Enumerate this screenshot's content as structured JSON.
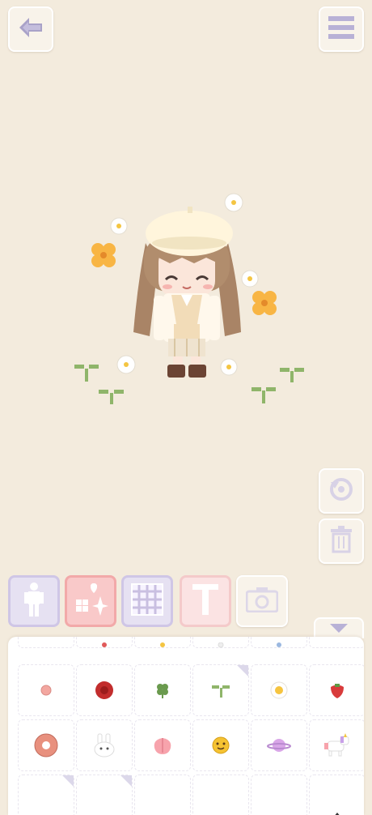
{
  "toolbar": {
    "back_icon": "arrow-left-icon",
    "menu_icon": "hamburger-menu-icon"
  },
  "side_actions": [
    {
      "name": "rotate-button",
      "icon": "rotate-icon"
    },
    {
      "name": "delete-button",
      "icon": "trash-icon"
    }
  ],
  "tabs": [
    {
      "name": "tab-character",
      "icon": "person-silhouette-icon",
      "bg": "#e6e1f2",
      "border": "#cfc6e6",
      "selected": false
    },
    {
      "name": "tab-stickers",
      "icon": "sparkle-clover-icon",
      "bg": "#f9c9c9",
      "border": "#f2a9a9",
      "selected": true
    },
    {
      "name": "tab-background",
      "icon": "grid-pattern-icon",
      "bg": "#e6e1f2",
      "border": "#cfc6e6",
      "selected": false
    },
    {
      "name": "tab-text",
      "icon": "letter-t-icon",
      "bg": "#fbe3e3",
      "border": "#f4caca",
      "selected": false
    },
    {
      "name": "tab-camera",
      "icon": "camera-icon",
      "bg": "#f8f3ea",
      "border": "#ffffff",
      "selected": false
    }
  ],
  "stickers": {
    "row_partial": [
      "red-dot",
      "flower-bit",
      "white-dot",
      "blue-dot"
    ],
    "row1": [
      {
        "name": "pink-dot-sticker",
        "icon": "pink-dot-icon"
      },
      {
        "name": "rose-sticker",
        "icon": "rose-icon"
      },
      {
        "name": "clover-sticker",
        "icon": "clover-icon"
      },
      {
        "name": "sprout-sticker",
        "icon": "sprout-icon"
      },
      {
        "name": "fried-egg-sticker",
        "icon": "fried-egg-icon"
      },
      {
        "name": "strawberry-sticker",
        "icon": "strawberry-icon"
      }
    ],
    "row2": [
      {
        "name": "donut-sticker",
        "icon": "donut-icon"
      },
      {
        "name": "bunny-sticker",
        "icon": "bunny-icon"
      },
      {
        "name": "peach-sticker",
        "icon": "peach-icon"
      },
      {
        "name": "smiley-sticker",
        "icon": "smiley-icon"
      },
      {
        "name": "planet-sticker",
        "icon": "planet-icon"
      },
      {
        "name": "unicorn-sticker",
        "icon": "unicorn-icon"
      }
    ]
  },
  "colors": {
    "canvas_bg": "#f3ebdd",
    "accent_pink": "#f9c9c9",
    "lavender": "#e6e1f2"
  }
}
